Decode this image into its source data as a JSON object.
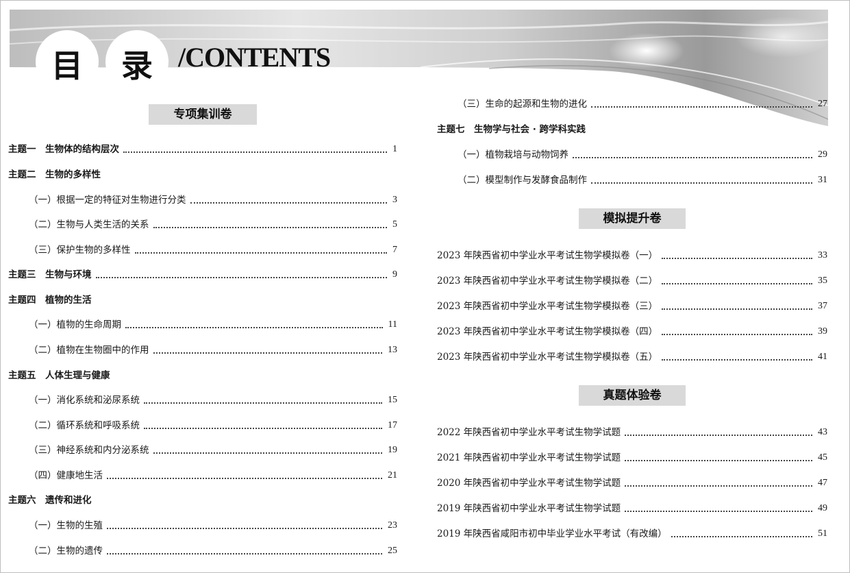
{
  "header": {
    "title_char_1": "目",
    "title_char_2": "录",
    "title_en": "/CONTENTS"
  },
  "left": {
    "section": "专项集训卷",
    "t1": {
      "label": "主题一　生物体的结构层次",
      "page": "1"
    },
    "t2": "主题二　生物的多样性",
    "t2_1": {
      "label": "（一）根据一定的特征对生物进行分类",
      "page": "3"
    },
    "t2_2": {
      "label": "（二）生物与人类生活的关系",
      "page": "5"
    },
    "t2_3": {
      "label": "（三）保护生物的多样性",
      "page": "7"
    },
    "t3": {
      "label": "主题三　生物与环境",
      "page": "9"
    },
    "t4": "主题四　植物的生活",
    "t4_1": {
      "label": "（一）植物的生命周期",
      "page": "11"
    },
    "t4_2": {
      "label": "（二）植物在生物圈中的作用",
      "page": "13"
    },
    "t5": "主题五　人体生理与健康",
    "t5_1": {
      "label": "（一）消化系统和泌尿系统",
      "page": "15"
    },
    "t5_2": {
      "label": "（二）循环系统和呼吸系统",
      "page": "17"
    },
    "t5_3": {
      "label": "（三）神经系统和内分泌系统",
      "page": "19"
    },
    "t5_4": {
      "label": "（四）健康地生活",
      "page": "21"
    },
    "t6": "主题六　遗传和进化",
    "t6_1": {
      "label": "（一）生物的生殖",
      "page": "23"
    },
    "t6_2": {
      "label": "（二）生物的遗传",
      "page": "25"
    }
  },
  "right": {
    "t6_3": {
      "label": "（三）生命的起源和生物的进化",
      "page": "27"
    },
    "t7": "主题七　生物学与社会 · 跨学科实践",
    "t7_1": {
      "label": "（一）植物栽培与动物饲养",
      "page": "29"
    },
    "t7_2": {
      "label": "（二）模型制作与发酵食品制作",
      "page": "31"
    },
    "section_mock": "模拟提升卷",
    "m1": {
      "label": "2023 年陕西省初中学业水平考试生物学模拟卷（一）",
      "page": "33"
    },
    "m2": {
      "label": "2023 年陕西省初中学业水平考试生物学模拟卷（二）",
      "page": "35"
    },
    "m3": {
      "label": "2023 年陕西省初中学业水平考试生物学模拟卷（三）",
      "page": "37"
    },
    "m4": {
      "label": "2023 年陕西省初中学业水平考试生物学模拟卷（四）",
      "page": "39"
    },
    "m5": {
      "label": "2023 年陕西省初中学业水平考试生物学模拟卷（五）",
      "page": "41"
    },
    "section_real": "真题体验卷",
    "r1": {
      "label": "2022 年陕西省初中学业水平考试生物学试题",
      "page": "43"
    },
    "r2": {
      "label": "2021 年陕西省初中学业水平考试生物学试题",
      "page": "45"
    },
    "r3": {
      "label": "2020 年陕西省初中学业水平考试生物学试题",
      "page": "47"
    },
    "r4": {
      "label": "2019 年陕西省初中学业水平考试生物学试题",
      "page": "49"
    },
    "r5": {
      "label": "2019 年陕西省咸阳市初中毕业学业水平考试（有改编）",
      "page": "51"
    }
  }
}
